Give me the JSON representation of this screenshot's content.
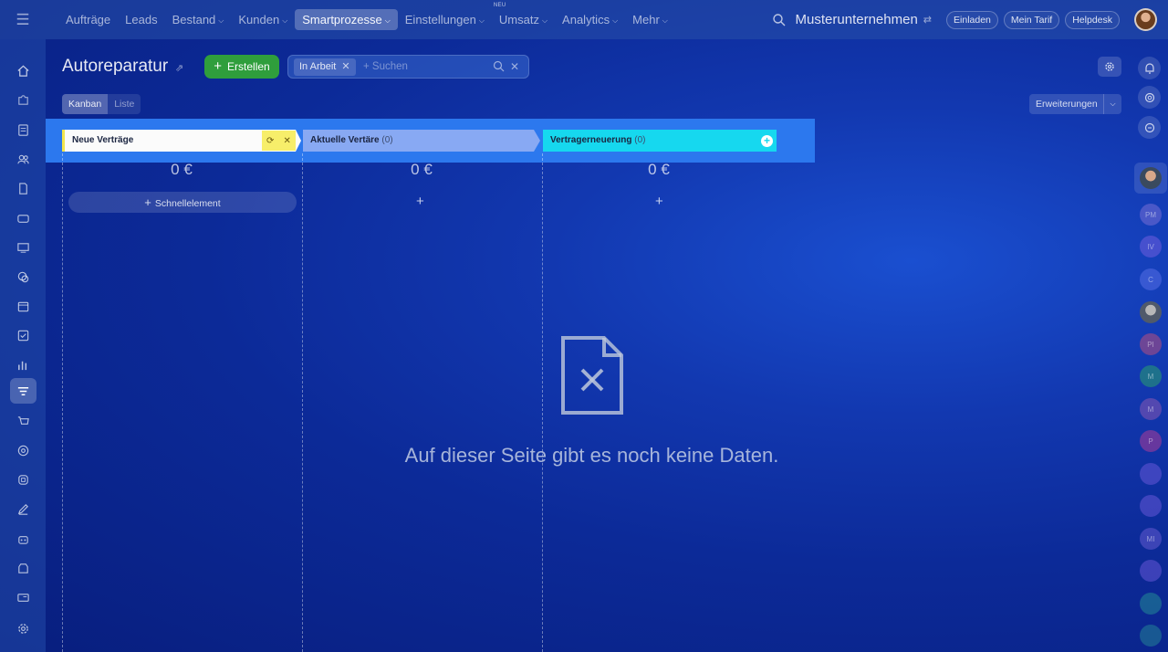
{
  "topbar": {
    "nav": [
      {
        "label": "Aufträge",
        "caret": false
      },
      {
        "label": "Leads",
        "caret": false
      },
      {
        "label": "Bestand",
        "caret": true
      },
      {
        "label": "Kunden",
        "caret": true
      },
      {
        "label": "Smartprozesse",
        "caret": true,
        "active": true
      },
      {
        "label": "Einstellungen",
        "caret": true
      },
      {
        "label": "Umsatz",
        "caret": true,
        "badge": "NEU"
      },
      {
        "label": "Analytics",
        "caret": true
      },
      {
        "label": "Mehr",
        "caret": true
      }
    ],
    "company": "Musterunternehmen",
    "buttons": {
      "invite": "Einladen",
      "tariff": "Mein Tarif",
      "help": "Helpdesk"
    }
  },
  "page": {
    "title": "Autoreparatur",
    "create_label": "Erstellen",
    "filter_tag": "In Arbeit",
    "search_placeholder": "+ Suchen",
    "view_kanban": "Kanban",
    "view_list": "Liste",
    "extensions_label": "Erweiterungen"
  },
  "stages": [
    {
      "name": "Neue Verträge",
      "count": "",
      "sum": "0 €",
      "color": "#f2e54d"
    },
    {
      "name": "Aktuelle Vertäre",
      "count": "(0)",
      "sum": "0 €",
      "color": "#88a9f3"
    },
    {
      "name": "Vertragerneuerung",
      "count": "(0)",
      "sum": "0 €",
      "color": "#16d8ef"
    }
  ],
  "quick_add": "Schnellelement",
  "empty_state": {
    "text": "Auf dieser Seite gibt es noch keine Daten.",
    "icon": "file-x-icon"
  },
  "right_avatars": [
    "PM",
    "IV",
    "C",
    "",
    "PI",
    "M",
    "M",
    "P",
    "",
    "",
    "MI",
    "",
    "",
    ""
  ]
}
